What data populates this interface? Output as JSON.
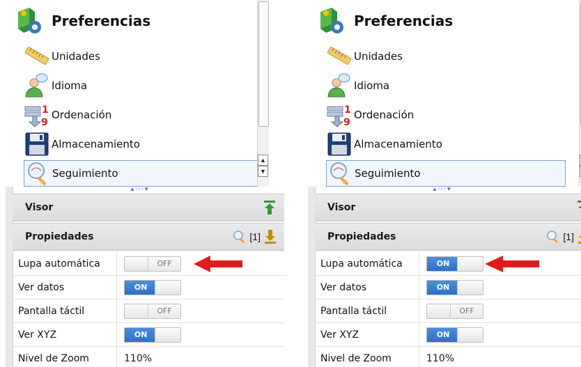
{
  "panels": [
    {
      "title": "Preferencias",
      "items": [
        {
          "label": "Unidades",
          "icon": "ruler-icon"
        },
        {
          "label": "Idioma",
          "icon": "user-speech-icon"
        },
        {
          "label": "Ordenación",
          "icon": "sort-19-icon"
        },
        {
          "label": "Almacenamiento",
          "icon": "floppy-disk-icon"
        },
        {
          "label": "Seguimiento",
          "icon": "tracking-magnifier-icon",
          "selected": true
        }
      ],
      "sections": {
        "viewer": "Visor",
        "properties": "Propiedades",
        "properties_count": "[1]"
      },
      "properties": [
        {
          "name": "Lupa automática",
          "on": false,
          "toggle_text": "OFF"
        },
        {
          "name": "Ver datos",
          "on": true,
          "toggle_text": "ON"
        },
        {
          "name": "Pantalla táctil",
          "on": false,
          "toggle_text": "OFF"
        },
        {
          "name": "Ver XYZ",
          "on": true,
          "toggle_text": "ON"
        },
        {
          "name": "Nivel de Zoom",
          "value": "110%"
        }
      ]
    },
    {
      "title": "Preferencias",
      "items": [
        {
          "label": "Unidades",
          "icon": "ruler-icon"
        },
        {
          "label": "Idioma",
          "icon": "user-speech-icon"
        },
        {
          "label": "Ordenación",
          "icon": "sort-19-icon"
        },
        {
          "label": "Almacenamiento",
          "icon": "floppy-disk-icon"
        },
        {
          "label": "Seguimiento",
          "icon": "tracking-magnifier-icon",
          "selected": true
        }
      ],
      "sections": {
        "viewer": "Visor",
        "properties": "Propiedades",
        "properties_count": "[1]"
      },
      "properties": [
        {
          "name": "Lupa automática",
          "on": true,
          "toggle_text": "ON"
        },
        {
          "name": "Ver datos",
          "on": true,
          "toggle_text": "ON"
        },
        {
          "name": "Pantalla táctil",
          "on": false,
          "toggle_text": "OFF"
        },
        {
          "name": "Ver XYZ",
          "on": true,
          "toggle_text": "ON"
        },
        {
          "name": "Nivel de Zoom",
          "value": "110%"
        }
      ]
    }
  ],
  "colors": {
    "accent_on": "#3a7bd5",
    "annotation_arrow": "#e01b1b"
  }
}
